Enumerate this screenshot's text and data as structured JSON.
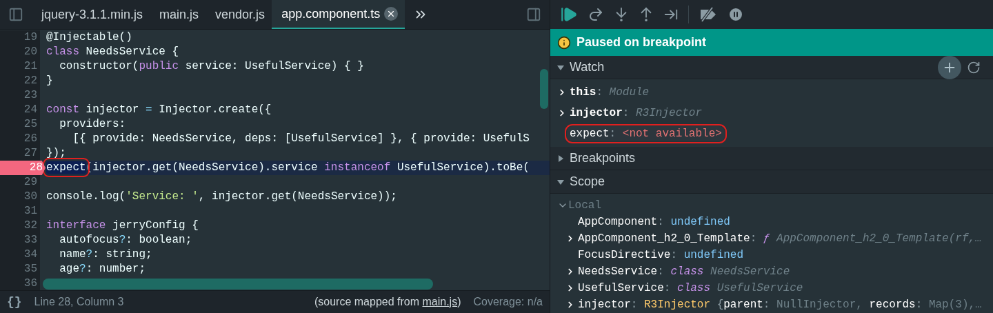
{
  "editor": {
    "tabs": [
      {
        "label": "jquery-3.1.1.min.js",
        "selected": false
      },
      {
        "label": "main.js",
        "selected": false
      },
      {
        "label": "vendor.js",
        "selected": false
      },
      {
        "label": "app.component.ts",
        "selected": true
      }
    ],
    "lines": [
      {
        "number": "19",
        "breakpoint": false,
        "tokens": [
          {
            "kind": "plain",
            "text": "@Injectable()"
          }
        ]
      },
      {
        "number": "20",
        "breakpoint": false,
        "tokens": [
          {
            "kind": "keyword",
            "text": "class"
          },
          {
            "kind": "plain",
            "text": " NeedsService {"
          }
        ]
      },
      {
        "number": "21",
        "breakpoint": false,
        "tokens": [
          {
            "kind": "plain",
            "text": "  constructor("
          },
          {
            "kind": "keyword",
            "text": "public"
          },
          {
            "kind": "plain",
            "text": " service: UsefulService) { }"
          }
        ]
      },
      {
        "number": "22",
        "breakpoint": false,
        "tokens": [
          {
            "kind": "plain",
            "text": "}"
          }
        ]
      },
      {
        "number": "23",
        "breakpoint": false
      },
      {
        "number": "24",
        "breakpoint": false,
        "tokens": [
          {
            "kind": "keyword",
            "text": "const"
          },
          {
            "kind": "plain",
            "text": " injector "
          },
          {
            "kind": "operator",
            "text": "="
          },
          {
            "kind": "plain",
            "text": " Injector.create({"
          }
        ]
      },
      {
        "number": "25",
        "breakpoint": false,
        "tokens": [
          {
            "kind": "plain",
            "text": "  providers:"
          }
        ]
      },
      {
        "number": "26",
        "breakpoint": false,
        "tokens": [
          {
            "kind": "plain",
            "text": "    [{ provide: NeedsService, deps: [UsefulService] }, { provide: UsefulS"
          }
        ]
      },
      {
        "number": "27",
        "breakpoint": false,
        "tokens": [
          {
            "kind": "plain",
            "text": "});"
          }
        ]
      },
      {
        "number": "28",
        "breakpoint": true,
        "tokens": [
          {
            "kind": "plain",
            "text": "expect",
            "annotated": true
          },
          {
            "kind": "plain",
            "text": "(injector.get(NeedsService).service "
          },
          {
            "kind": "keyword",
            "text": "instanceof"
          },
          {
            "kind": "plain",
            "text": " UsefulService).toBe("
          }
        ]
      },
      {
        "number": "29",
        "breakpoint": false
      },
      {
        "number": "30",
        "breakpoint": false,
        "tokens": [
          {
            "kind": "plain",
            "text": "console.log("
          },
          {
            "kind": "string",
            "text": "'Service: '"
          },
          {
            "kind": "plain",
            "text": ", injector.get(NeedsService));"
          }
        ]
      },
      {
        "number": "31",
        "breakpoint": false
      },
      {
        "number": "32",
        "breakpoint": false,
        "tokens": [
          {
            "kind": "keyword",
            "text": "interface"
          },
          {
            "kind": "plain",
            "text": " jerryConfig {"
          }
        ]
      },
      {
        "number": "33",
        "breakpoint": false,
        "tokens": [
          {
            "kind": "plain",
            "text": "  autofocus"
          },
          {
            "kind": "operator",
            "text": "?"
          },
          {
            "kind": "plain",
            "text": ": boolean;"
          }
        ]
      },
      {
        "number": "34",
        "breakpoint": false,
        "tokens": [
          {
            "kind": "plain",
            "text": "  name"
          },
          {
            "kind": "operator",
            "text": "?"
          },
          {
            "kind": "plain",
            "text": ": string;"
          }
        ]
      },
      {
        "number": "35",
        "breakpoint": false,
        "tokens": [
          {
            "kind": "plain",
            "text": "  age"
          },
          {
            "kind": "operator",
            "text": "?"
          },
          {
            "kind": "plain",
            "text": ": number;"
          }
        ]
      },
      {
        "number": "36",
        "breakpoint": false
      }
    ],
    "status_bar": {
      "format_button": "{}",
      "position": "Line 28, Column 3",
      "source_prefix": "(source mapped from ",
      "source_link": "main.js",
      "source_suffix": ")",
      "coverage": "Coverage: n/a"
    }
  },
  "debugger": {
    "banner": "Paused on breakpoint",
    "sections": [
      {
        "kind": "watch",
        "title": "Watch",
        "expanded": true,
        "items": [
          {
            "name": "this",
            "expandable": true,
            "annotated": false,
            "value": [
              {
                "kind": "sep",
                "text": ": "
              },
              {
                "kind": "dim",
                "text": "Module"
              }
            ]
          },
          {
            "name": "injector",
            "expandable": true,
            "annotated": false,
            "value": [
              {
                "kind": "sep",
                "text": ": "
              },
              {
                "kind": "dim",
                "text": "R3Injector"
              }
            ]
          },
          {
            "name": "expect",
            "expandable": false,
            "annotated": true,
            "value": [
              {
                "kind": "sep",
                "text": ": "
              },
              {
                "kind": "error",
                "text": "<not available>"
              }
            ]
          }
        ]
      },
      {
        "kind": "breakpoints",
        "title": "Breakpoints",
        "expanded": false
      },
      {
        "kind": "scope",
        "title": "Scope",
        "expanded": true,
        "group": "Local",
        "group_expanded": true,
        "items": [
          {
            "name": "AppComponent",
            "expandable": false,
            "value": [
              {
                "kind": "sep",
                "text": ": "
              },
              {
                "kind": "undefined",
                "text": "undefined"
              }
            ]
          },
          {
            "name": "AppComponent_h2_0_Template",
            "expandable": true,
            "value": [
              {
                "kind": "sep",
                "text": ": "
              },
              {
                "kind": "keyword",
                "text": "ƒ"
              },
              {
                "kind": "dim",
                "text": " AppComponent_h2_0_Template(rf,…"
              }
            ]
          },
          {
            "name": "FocusDirective",
            "expandable": false,
            "value": [
              {
                "kind": "sep",
                "text": ": "
              },
              {
                "kind": "undefined",
                "text": "undefined"
              }
            ]
          },
          {
            "name": "NeedsService",
            "expandable": true,
            "value": [
              {
                "kind": "sep",
                "text": ": "
              },
              {
                "kind": "keyword",
                "text": "class"
              },
              {
                "kind": "dim",
                "text": " NeedsService"
              }
            ]
          },
          {
            "name": "UsefulService",
            "expandable": true,
            "value": [
              {
                "kind": "sep",
                "text": ": "
              },
              {
                "kind": "keyword",
                "text": "class"
              },
              {
                "kind": "dim",
                "text": " UsefulService"
              }
            ]
          },
          {
            "name": "injector",
            "expandable": true,
            "value": [
              {
                "kind": "sep",
                "text": ": "
              },
              {
                "kind": "typename",
                "text": "R3Injector"
              },
              {
                "kind": "plainv",
                "text": " {"
              },
              {
                "kind": "key",
                "text": "parent"
              },
              {
                "kind": "plainv",
                "text": ": "
              },
              {
                "kind": "dimn",
                "text": "NullInjector, "
              },
              {
                "kind": "key",
                "text": "records"
              },
              {
                "kind": "plainv",
                "text": ": "
              },
              {
                "kind": "dimn",
                "text": "Map(3),…"
              }
            ]
          }
        ]
      }
    ]
  }
}
